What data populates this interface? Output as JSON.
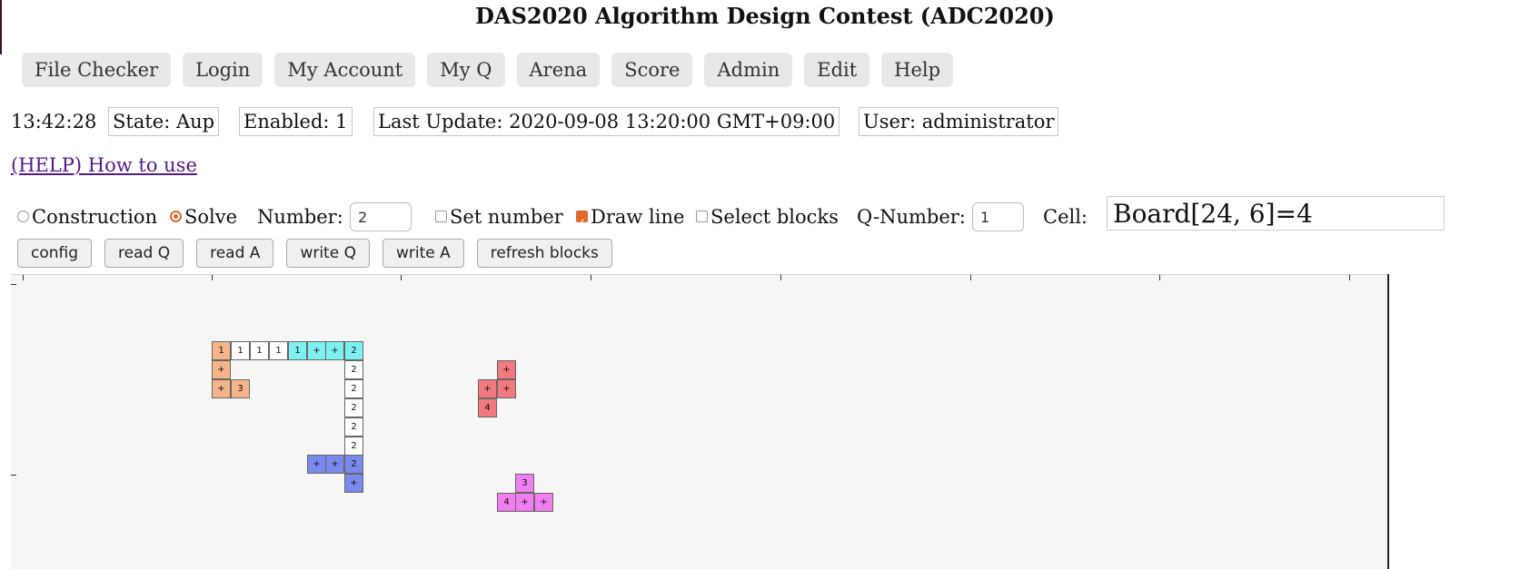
{
  "title": "DAS2020 Algorithm Design Contest (ADC2020)",
  "nav": [
    "File Checker",
    "Login",
    "My Account",
    "My Q",
    "Arena",
    "Score",
    "Admin",
    "Edit",
    "Help"
  ],
  "status": {
    "time": "13:42:28",
    "state": "State: Aup",
    "enabled": "Enabled: 1",
    "last_update": "Last Update: 2020-09-08 13:20:00 GMT+09:00",
    "user": "User: administrator"
  },
  "help_link": "(HELP) How to use",
  "controls": {
    "construction_label": "Construction",
    "solve_label": "Solve",
    "mode_selected": "Solve",
    "number_label": "Number:",
    "number_value": "2",
    "set_number_label": "Set number",
    "set_number_checked": false,
    "draw_line_label": "Draw line",
    "draw_line_checked": true,
    "select_blocks_label": "Select blocks",
    "select_blocks_checked": false,
    "qnumber_label": "Q-Number:",
    "qnumber_value": "1",
    "cell_label": "Cell:",
    "cell_value": "Board[24, 6]=4"
  },
  "tools": [
    "config",
    "read Q",
    "read A",
    "write Q",
    "write A",
    "refresh blocks"
  ],
  "colors": {
    "orange": "#f5b48a",
    "cyan": "#7ff0f0",
    "white": "#ffffff",
    "blue": "#7b88ec",
    "red": "#f2797f",
    "magenta": "#f07ef0",
    "accent": "#e06a2c"
  },
  "board": {
    "cells": [
      {
        "col": 0,
        "row": 0,
        "text": "1",
        "color": "orange"
      },
      {
        "col": 1,
        "row": 0,
        "text": "1",
        "color": "white"
      },
      {
        "col": 2,
        "row": 0,
        "text": "1",
        "color": "white"
      },
      {
        "col": 3,
        "row": 0,
        "text": "1",
        "color": "white"
      },
      {
        "col": 4,
        "row": 0,
        "text": "1",
        "color": "cyan"
      },
      {
        "col": 5,
        "row": 0,
        "text": "+",
        "color": "cyan"
      },
      {
        "col": 6,
        "row": 0,
        "text": "+",
        "color": "cyan"
      },
      {
        "col": 7,
        "row": 0,
        "text": "2",
        "color": "cyan"
      },
      {
        "col": 0,
        "row": 1,
        "text": "+",
        "color": "orange"
      },
      {
        "col": 7,
        "row": 1,
        "text": "2",
        "color": "white"
      },
      {
        "col": 0,
        "row": 2,
        "text": "+",
        "color": "orange"
      },
      {
        "col": 1,
        "row": 2,
        "text": "3",
        "color": "orange"
      },
      {
        "col": 7,
        "row": 2,
        "text": "2",
        "color": "white"
      },
      {
        "col": 7,
        "row": 3,
        "text": "2",
        "color": "white"
      },
      {
        "col": 7,
        "row": 4,
        "text": "2",
        "color": "white"
      },
      {
        "col": 7,
        "row": 5,
        "text": "2",
        "color": "white"
      },
      {
        "col": 5,
        "row": 6,
        "text": "+",
        "color": "blue"
      },
      {
        "col": 6,
        "row": 6,
        "text": "+",
        "color": "blue"
      },
      {
        "col": 7,
        "row": 6,
        "text": "2",
        "color": "blue"
      },
      {
        "col": 7,
        "row": 7,
        "text": "+",
        "color": "blue"
      },
      {
        "col": 15,
        "row": 1,
        "text": "+",
        "color": "red"
      },
      {
        "col": 14,
        "row": 2,
        "text": "+",
        "color": "red"
      },
      {
        "col": 15,
        "row": 2,
        "text": "+",
        "color": "red"
      },
      {
        "col": 14,
        "row": 3,
        "text": "4",
        "color": "red"
      },
      {
        "col": 16,
        "row": 7,
        "text": "3",
        "color": "magenta"
      },
      {
        "col": 15,
        "row": 8,
        "text": "4",
        "color": "magenta"
      },
      {
        "col": 16,
        "row": 8,
        "text": "+",
        "color": "magenta"
      },
      {
        "col": 17,
        "row": 8,
        "text": "+",
        "color": "magenta"
      }
    ]
  }
}
